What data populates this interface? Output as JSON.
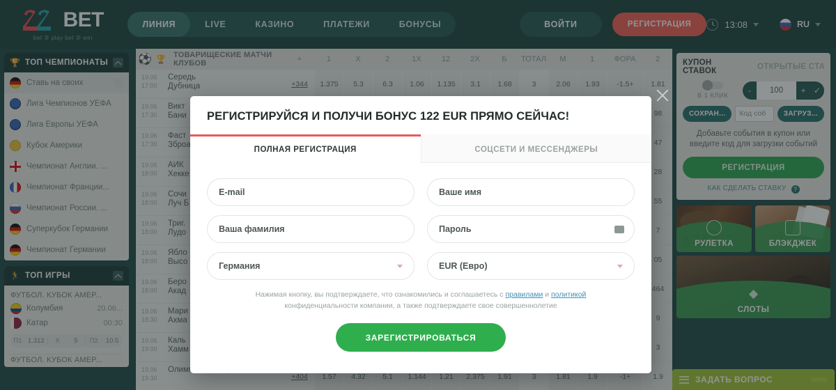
{
  "header": {
    "logo": {
      "mark": "22",
      "word": "BET",
      "tagline": "bet ② play  bet ② win"
    },
    "nav": [
      {
        "label": "ЛИНИЯ",
        "active": true
      },
      {
        "label": "LIVE",
        "active": false
      },
      {
        "label": "КАЗИНО",
        "active": false
      },
      {
        "label": "ПЛАТЕЖИ",
        "active": false
      },
      {
        "label": "БОНУСЫ",
        "active": false
      }
    ],
    "login_label": "ВОЙТИ",
    "register_label": "РЕГИСТРАЦИЯ",
    "clock": "13:08",
    "language": "RU",
    "accent_red": "#f4564e",
    "accent_teal": "#0f3936"
  },
  "sidebar": {
    "top_champ": {
      "title": "ТОП ЧЕМПИОНАТЫ",
      "icon": "trophy-icon",
      "items": [
        {
          "label": "Ставь на своих",
          "flag": "f-de",
          "selected": true
        },
        {
          "label": "Лига Чемпионов УЕФА",
          "flag": "f-uefa",
          "selected": false
        },
        {
          "label": "Лига Европы УЕФА",
          "flag": "f-uefa",
          "selected": false
        },
        {
          "label": "Кубок Америки",
          "flag": "f-cup",
          "selected": false
        },
        {
          "label": "Чемпионат Англии. ...",
          "flag": "f-en",
          "selected": false
        },
        {
          "label": "Чемпионат Франции...",
          "flag": "f-fr",
          "selected": false
        },
        {
          "label": "Чемпионат России. ...",
          "flag": "f-ru",
          "selected": false
        },
        {
          "label": "Суперкубок Германии",
          "flag": "f-de",
          "selected": false
        },
        {
          "label": "Чемпионат Германии",
          "flag": "f-de",
          "selected": false
        }
      ]
    },
    "top_games": {
      "title": "ТОП ИГРЫ",
      "icon": "person-icon",
      "blocks": [
        {
          "league": "ФУТБОЛ. КУБОК АМЕР...",
          "teams": [
            {
              "name": "Колумбия",
              "flag": "f-co",
              "time": "20.06..."
            },
            {
              "name": "Катар",
              "flag": "f-qa",
              "time": "00:30"
            }
          ],
          "odds": [
            {
              "key": "П1",
              "value": "1.312"
            },
            {
              "key": "X",
              "value": "5"
            },
            {
              "key": "П2",
              "value": "10.5"
            }
          ]
        },
        {
          "league": "ФУТБОЛ. КУБОК АМЕР...",
          "teams": [],
          "odds": []
        }
      ]
    }
  },
  "main": {
    "table_header": {
      "sport_icon": "football-icon",
      "cup_icon": "trophy-icon",
      "league": "ТОВАРИЩЕСКИЕ МАТЧИ КЛУБОВ",
      "columns": [
        "+",
        "1",
        "X",
        "2",
        "1X",
        "12",
        "2X",
        "Б",
        "ТОТАЛ",
        "М",
        "1",
        "ФОРА",
        "2"
      ]
    },
    "rows": [
      {
        "date": "19.06",
        "time": "17:00",
        "team1": "Середь",
        "team2": "Дубница",
        "plus": "+344",
        "odds": [
          "1.375",
          "5.3",
          "6.3",
          "1.06",
          "1.135",
          "3.1",
          "1.68",
          "3",
          "2.06",
          "1.93",
          "-1.5+",
          "1.81"
        ]
      },
      {
        "date": "19.06",
        "time": "17:30",
        "team1": "Викт",
        "team2": "Бани",
        "plus": "",
        "odds": [
          "",
          "",
          "",
          "",
          "",
          "",
          "",
          "",
          "",
          "",
          "",
          "98"
        ]
      },
      {
        "date": "19.06",
        "time": "17:30",
        "team1": "Фаст",
        "team2": "Зброа",
        "plus": "",
        "odds": [
          "",
          "",
          "",
          "",
          "",
          "",
          "",
          "",
          "",
          "",
          "",
          "47"
        ]
      },
      {
        "date": "19.06",
        "time": "18:00",
        "team1": "АИК ",
        "team2": "Хекке",
        "plus": "",
        "odds": [
          "",
          "",
          "",
          "",
          "",
          "",
          "",
          "",
          "",
          "",
          "",
          "28"
        ]
      },
      {
        "date": "19.06",
        "time": "18:00",
        "team1": "Сочи",
        "team2": "Луч Б",
        "plus": "",
        "odds": [
          "",
          "",
          "",
          "",
          "",
          "",
          "",
          "",
          "",
          "",
          "",
          "55"
        ]
      },
      {
        "date": "19.06",
        "time": "18:00",
        "team1": "Триг.",
        "team2": "Лудо",
        "plus": "",
        "odds": [
          "",
          "",
          "",
          "",
          "",
          "",
          "",
          "",
          "",
          "",
          "",
          "7"
        ]
      },
      {
        "date": "19.06",
        "time": "18:00",
        "team1": "Ябло",
        "team2": "Высо",
        "plus": "",
        "odds": [
          "",
          "",
          "",
          "",
          "",
          "",
          "",
          "",
          "",
          "",
          "",
          "05"
        ]
      },
      {
        "date": "19.06",
        "time": "18:00",
        "team1": "Беро",
        "team2": "Акад",
        "plus": "",
        "odds": [
          "",
          "",
          "",
          "",
          "",
          "",
          "",
          "",
          "",
          "",
          "",
          "464"
        ]
      },
      {
        "date": "19.06",
        "time": "18:30",
        "team1": "Мари",
        "team2": "Ахма",
        "plus": "",
        "odds": [
          "",
          "",
          "",
          "",
          "",
          "",
          "",
          "",
          "",
          "",
          "",
          "9"
        ]
      },
      {
        "date": "19.06",
        "time": "19:00",
        "team1": "Каль",
        "team2": "Хамм",
        "plus": "",
        "odds": [
          "",
          "",
          "",
          "",
          "",
          "",
          "",
          "",
          "",
          "",
          "",
          "3"
        ]
      },
      {
        "date": "19.06",
        "time": "19:30",
        "team1": "Олимпиакос Пирей",
        "team2": "",
        "plus": "+404",
        "odds": [
          "1.57",
          "4.32",
          "5.1",
          "1.144",
          "1.21",
          "2.375",
          "1.91",
          "3",
          "1.81",
          "1.9",
          "-1+",
          "1.9"
        ]
      }
    ]
  },
  "coupon": {
    "tab_active": "КУПОН СТАВОК",
    "tab_inactive": "ОТКРЫТЫЕ СТА...",
    "one_click_label": "В 1 КЛИК",
    "stake_value": "100",
    "minus": "-",
    "plus": "+",
    "check": "✓",
    "save_label": "СОХРАН...",
    "code_placeholder": "Код соб",
    "load_label": "ЗАГРУЗ...",
    "hint": "Добавьте события в купон или введите код для загрузки событий",
    "register_label": "РЕГИСТРАЦИЯ",
    "how_to_label": "КАК СДЕЛАТЬ СТАВКУ",
    "help_icon": "question-icon"
  },
  "tiles": [
    {
      "label": "РУЛЕТКА",
      "icon": "roulette-icon",
      "bg": "bg-roulette"
    },
    {
      "label": "БЛЭКДЖЕК",
      "icon": "cards-icon",
      "bg": "bg-blackjack"
    },
    {
      "label": "СЛОТЫ",
      "icon": "diamond-icon",
      "bg": "bg-slots"
    }
  ],
  "ask": {
    "label": "ЗАДАТЬ ВОПРОС",
    "icon": "menu-icon",
    "pill": ""
  },
  "modal": {
    "title": "РЕГИСТРИРУЙСЯ И ПОЛУЧИ БОНУС 122 EUR ПРЯМО СЕЙЧАС!",
    "tabs": [
      {
        "label": "ПОЛНАЯ РЕГИСТРАЦИЯ",
        "active": true
      },
      {
        "label": "СОЦСЕТИ И МЕССЕНДЖЕРЫ",
        "active": false
      }
    ],
    "fields": {
      "email": "E-mail",
      "first_name": "Ваше имя",
      "last_name": "Ваша фамилия",
      "password": "Пароль",
      "country": "Германия",
      "currency": "EUR (Евро)"
    },
    "terms_1": "Нажимая кнопку, вы подтверждаете, что ознакомились и соглашаетесь с ",
    "terms_link_1": "правилами",
    "terms_2": " и ",
    "terms_link_2": "политикой",
    "terms_3": "конфиденциальности компании, а также подтверждаете свое совершеннолетие",
    "submit_label": "ЗАРЕГИСТРИРОВАТЬСЯ",
    "close_icon": "close-icon",
    "accent_tab": "#e8595a",
    "accent_submit": "#2fae4e"
  }
}
